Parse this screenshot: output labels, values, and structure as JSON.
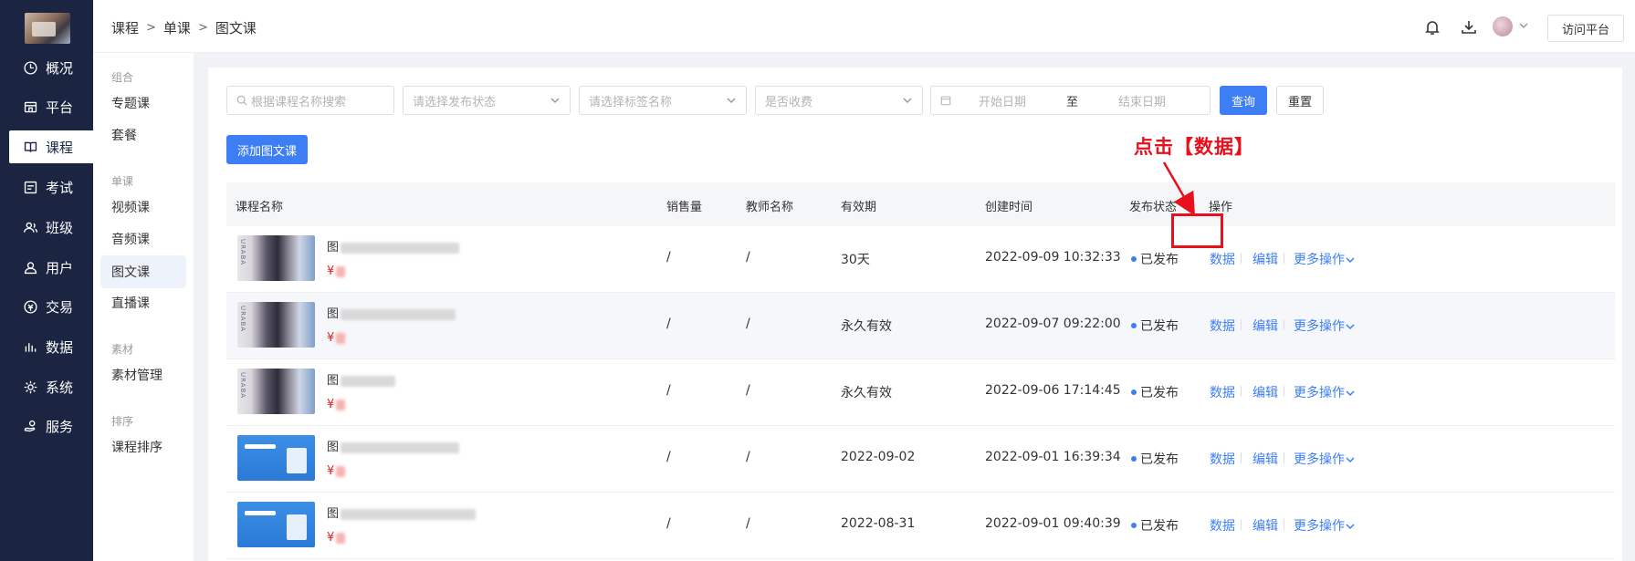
{
  "nav": {
    "items": [
      {
        "label": "概况",
        "icon": "clock-icon"
      },
      {
        "label": "平台",
        "icon": "store-icon"
      },
      {
        "label": "课程",
        "icon": "book-icon",
        "active": true
      },
      {
        "label": "考试",
        "icon": "exam-icon"
      },
      {
        "label": "班级",
        "icon": "group-icon"
      },
      {
        "label": "用户",
        "icon": "user-icon"
      },
      {
        "label": "交易",
        "icon": "money-icon"
      },
      {
        "label": "数据",
        "icon": "bar-chart-icon"
      },
      {
        "label": "系统",
        "icon": "gear-icon"
      },
      {
        "label": "服务",
        "icon": "service-icon"
      }
    ]
  },
  "submenu": {
    "groups": [
      {
        "label": "组合",
        "items": [
          "专题课",
          "套餐"
        ]
      },
      {
        "label": "单课",
        "items": [
          "视频课",
          "音频课",
          "图文课",
          "直播课"
        ]
      },
      {
        "label": "素材",
        "items": [
          "素材管理"
        ]
      },
      {
        "label": "排序",
        "items": [
          "课程排序"
        ]
      }
    ],
    "active": "图文课"
  },
  "header": {
    "breadcrumb": [
      "课程",
      "单课",
      "图文课"
    ],
    "visit_label": "访问平台"
  },
  "filters": {
    "search_placeholder": "根据课程名称搜索",
    "status_placeholder": "请选择发布状态",
    "tag_placeholder": "请选择标签名称",
    "charge_placeholder": "是否收费",
    "start_date_placeholder": "开始日期",
    "date_sep": "至",
    "end_date_placeholder": "结束日期",
    "query_label": "查询",
    "reset_label": "重置"
  },
  "add_button_label": "添加图文课",
  "table": {
    "columns": [
      "课程名称",
      "销售量",
      "教师名称",
      "有效期",
      "创建时间",
      "发布状态",
      "操作"
    ],
    "rows": [
      {
        "title_prefix": "图",
        "price_prefix": "¥",
        "sales": "/",
        "teacher": "/",
        "validity": "30天",
        "created": "2022-09-09 10:32:33",
        "status": "已发布",
        "thumb": "dress"
      },
      {
        "title_prefix": "图",
        "price_prefix": "¥",
        "sales": "/",
        "teacher": "/",
        "validity": "永久有效",
        "created": "2022-09-07 09:22:00",
        "status": "已发布",
        "thumb": "dress"
      },
      {
        "title_prefix": "图",
        "price_prefix": "¥",
        "sales": "/",
        "teacher": "/",
        "validity": "永久有效",
        "created": "2022-09-06 17:14:45",
        "status": "已发布",
        "thumb": "dress"
      },
      {
        "title_prefix": "图",
        "price_prefix": "¥",
        "sales": "/",
        "teacher": "/",
        "validity": "2022-09-02",
        "created": "2022-09-01 16:39:34",
        "status": "已发布",
        "thumb": "blue"
      },
      {
        "title_prefix": "图",
        "price_prefix": "¥",
        "sales": "/",
        "teacher": "/",
        "validity": "2022-08-31",
        "created": "2022-09-01 09:40:39",
        "status": "已发布",
        "thumb": "blue"
      }
    ],
    "ops": {
      "data": "数据",
      "edit": "编辑",
      "more": "更多操作"
    }
  },
  "annotation": {
    "text": "点击【数据】",
    "color": "#e8101c"
  },
  "colors": {
    "primary": "#3d7ef5",
    "nav_bg": "#1b2541",
    "price": "#ee1c1c"
  }
}
